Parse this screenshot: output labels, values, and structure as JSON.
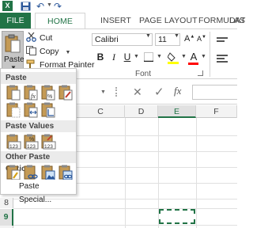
{
  "quick_access": {
    "app_icon_letter": "X"
  },
  "tabs": {
    "file": "FILE",
    "home": "HOME",
    "insert": "INSERT",
    "page_layout": "PAGE LAYOUT",
    "formulas": "FORMULAS",
    "data": "DAT"
  },
  "clipboard": {
    "paste_label": "Paste",
    "cut_label": "Cut",
    "copy_label": "Copy",
    "format_painter_label": "Format Painter"
  },
  "font": {
    "family": "Calibri",
    "size": "11",
    "group_label": "Font",
    "bold": "B",
    "italic": "I",
    "underline": "U",
    "font_color_glyph": "A",
    "grow_glyph": "A",
    "shrink_glyph": "A",
    "colors": {
      "font_color_bar": "#ff0000",
      "fill_color_bar": "#ffff00"
    }
  },
  "formula_bar": {
    "cancel_glyph": "✕",
    "enter_glyph": "✓",
    "fx_label": "fx"
  },
  "grid": {
    "columns": [
      "C",
      "D",
      "E",
      "F"
    ],
    "selected_column": "E",
    "rows": [
      "8",
      "9"
    ],
    "selected_row": "9"
  },
  "paste_menu": {
    "paste_header": "Paste",
    "paste_values_header": "Paste Values",
    "other_header": "Other Paste Options",
    "value_icon_text": "123",
    "percent_text": "%",
    "paste_special": "Paste Special..."
  },
  "colors": {
    "accent": "#217346",
    "ribbon_bg": "#ffffff",
    "menu_header_bg": "#ebebeb"
  }
}
